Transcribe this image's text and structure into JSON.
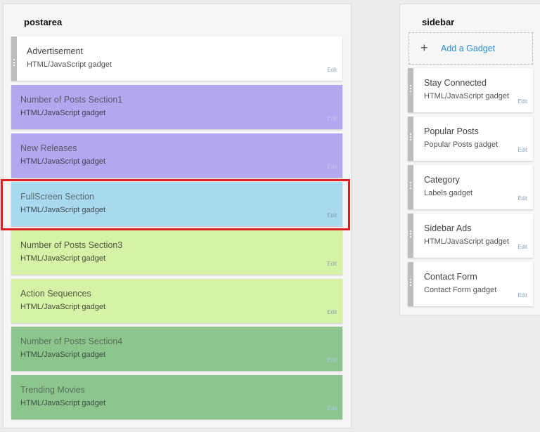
{
  "postarea": {
    "title": "postarea",
    "gadgets": [
      {
        "title": "Advertisement",
        "subtitle": "HTML/JavaScript gadget",
        "edit": "Edit",
        "bg": "#ffffff"
      },
      {
        "title": "Number of Posts Section1",
        "subtitle": "HTML/JavaScript gadget",
        "edit": "Edit",
        "bg": "#b3a7f0"
      },
      {
        "title": "New Releases",
        "subtitle": "HTML/JavaScript gadget",
        "edit": "Edit",
        "bg": "#b3a7f0"
      },
      {
        "title": "FullScreen Section",
        "subtitle": "HTML/JavaScript gadget",
        "edit": "Edit",
        "bg": "#a9d9ef"
      },
      {
        "title": "Number of Posts Section3",
        "subtitle": "HTML/JavaScript gadget",
        "edit": "Edit",
        "bg": "#d6f2a6"
      },
      {
        "title": "Action Sequences",
        "subtitle": "HTML/JavaScript gadget",
        "edit": "Edit",
        "bg": "#d6f2a6"
      },
      {
        "title": "Number of Posts Section4",
        "subtitle": "HTML/JavaScript gadget",
        "edit": "Edit",
        "bg": "#8cc68e"
      },
      {
        "title": "Trending Movies",
        "subtitle": "HTML/JavaScript gadget",
        "edit": "Edit",
        "bg": "#8cc68e"
      }
    ]
  },
  "sidebar": {
    "title": "sidebar",
    "add_gadget_label": "Add a Gadget",
    "add_gadget_icon": "plus-icon",
    "gadgets": [
      {
        "title": "Stay Connected",
        "subtitle": "HTML/JavaScript gadget",
        "edit": "Edit"
      },
      {
        "title": "Popular Posts",
        "subtitle": "Popular Posts gadget",
        "edit": "Edit"
      },
      {
        "title": "Category",
        "subtitle": "Labels gadget",
        "edit": "Edit"
      },
      {
        "title": "Sidebar Ads",
        "subtitle": "HTML/JavaScript gadget",
        "edit": "Edit"
      },
      {
        "title": "Contact Form",
        "subtitle": "Contact Form gadget",
        "edit": "Edit"
      }
    ]
  },
  "colors": {
    "highlight": "#e02020",
    "link": "#2a8fcf",
    "handle": "#bdbdbd"
  }
}
